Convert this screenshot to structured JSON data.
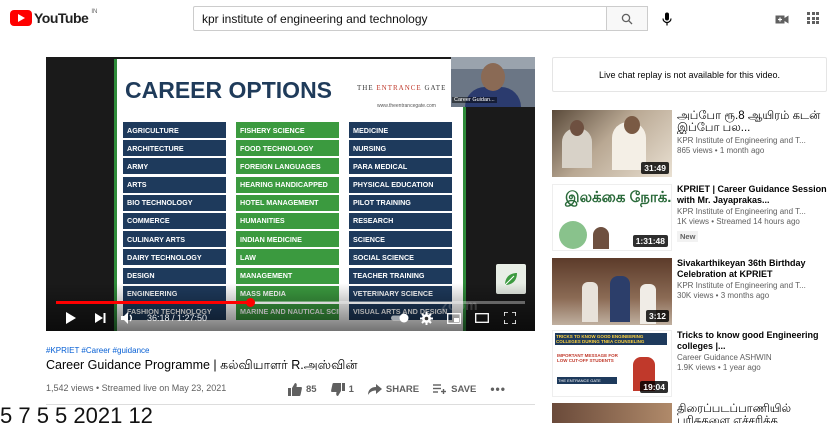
{
  "header": {
    "logo_text": "YouTube",
    "logo_region": "IN",
    "search_value": "kpr institute of engineering and technology",
    "icons": [
      "search-icon",
      "mic-icon",
      "create-video-icon",
      "apps-icon"
    ]
  },
  "player": {
    "slide_title": "CAREER OPTIONS",
    "brand_pre": "THE ",
    "brand_accent": "ENTRANCE",
    "brand_post": " GATE",
    "brand_url": "www.theentrancegate.com",
    "webcam_label": "Career Guidan...",
    "options": [
      [
        "AGRICULTURE",
        "FISHERY SCIENCE",
        "MEDICINE"
      ],
      [
        "ARCHITECTURE",
        "FOOD TECHNOLOGY",
        "NURSING"
      ],
      [
        "ARMY",
        "FOREIGN LANGUAGES",
        "PARA MEDICAL"
      ],
      [
        "ARTS",
        "HEARING HANDICAPPED",
        "PHYSICAL EDUCATION"
      ],
      [
        "BIO TECHNOLOGY",
        "HOTEL MANAGEMENT",
        "PILOT TRAINING"
      ],
      [
        "COMMERCE",
        "HUMANITIES",
        "RESEARCH"
      ],
      [
        "CULINARY ARTS",
        "INDIAN MEDICINE",
        "SCIENCE"
      ],
      [
        "DAIRY TECHNOLOGY",
        "LAW",
        "SOCIAL SCIENCE"
      ],
      [
        "DESIGN",
        "MANAGEMENT",
        "TEACHER TRAINING"
      ],
      [
        "ENGINEERING",
        "MASS MEDIA",
        "VETERINARY SCIENCE"
      ],
      [
        "FASHION TECHNOLOGY",
        "MARINE AND NAUTICAL SCIENCES",
        "VISUAL ARTS AND DESIGN"
      ]
    ],
    "time_display": "36:18 / 1:27:50",
    "progress_fraction": 0.413,
    "watermark": "zoom"
  },
  "video": {
    "hashtags": "#KPRIET #Career #guidance",
    "title": "Career Guidance Programme | கல்வியாளர் R.அஸ்வின்",
    "meta": "1,542 views • Streamed live on May 23, 2021",
    "like_count": "85",
    "dislike_count": "1",
    "share_label": "SHARE",
    "save_label": "SAVE",
    "more_label": "•••"
  },
  "overlay_text": "5 7 5 5    2021          12",
  "sidebar": {
    "chat_notice": "Live chat replay is not available for this video.",
    "recommendations": [
      {
        "title": "அப்போ ரூ.8 ஆயிரம் கடன் இப்போ பல...",
        "channel": "KPR Institute of Engineering and T...",
        "views": "865 views • 1 month ago",
        "duration": "31:49",
        "badge": ""
      },
      {
        "title": "KPRIET | Career Guidance Session with Mr. Jayaprakas...",
        "channel": "KPR Institute of Engineering and T...",
        "views": "1K views • Streamed 14 hours ago",
        "duration": "1:31:48",
        "badge": "New",
        "thumb_text": "இலக்கை நோக்..."
      },
      {
        "title": "Sivakarthikeyan 36th Birthday Celebration at KPRIET",
        "channel": "KPR Institute of Engineering and T...",
        "views": "30K views • 3 months ago",
        "duration": "3:12",
        "badge": ""
      },
      {
        "title": "Tricks to know good Engineering colleges |...",
        "channel": "Career Guidance ASHWIN",
        "views": "1.9K views • 1 year ago",
        "duration": "19:04",
        "badge": "",
        "thumb_line1": "TRICKS TO KNOW GOOD ENGINEERING COLLEGES DURING TNEA COUNSELING",
        "thumb_line2": "IMPORTANT MESSAGE FOR LOW CUT-OFF STUDENTS",
        "thumb_line3": "THE ENTRANCE GATE"
      },
      {
        "title": "திரைப்படப்பாணியில் பரிசுகளை எச்சரிக்க",
        "channel": "",
        "views": "",
        "duration": "",
        "badge": ""
      }
    ]
  },
  "colors": {
    "brand_red": "#ff0000",
    "slide_navy": "#1e3a5c",
    "slide_green": "#3b9a3f",
    "link_blue": "#065fd4"
  }
}
